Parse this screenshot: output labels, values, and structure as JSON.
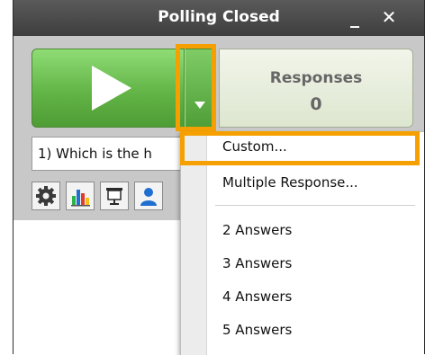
{
  "window": {
    "title": "Polling Closed",
    "minimize_glyph": "_",
    "close_glyph": "✕"
  },
  "poll": {
    "start_button_icon": "play-icon",
    "dropdown_icon": "caret-down-icon",
    "responses_label": "Responses",
    "responses_count": "0",
    "question_text": "1) Which is the h"
  },
  "toolbar_icons": [
    "gear-icon",
    "bar-chart-icon",
    "presentation-icon",
    "user-icon"
  ],
  "dropdown_menu": {
    "items": [
      {
        "label": "Custom..."
      },
      {
        "label": "Multiple Response..."
      },
      {
        "label": "2 Answers"
      },
      {
        "label": "3 Answers"
      },
      {
        "label": "4 Answers"
      },
      {
        "label": "5 Answers"
      }
    ]
  },
  "colors": {
    "highlight": "#f5a000",
    "play_green": "#63b547",
    "titlebar": "#4a4a4a",
    "chart_bars": [
      "#2bb34a",
      "#1f6fd1",
      "#e23b2a",
      "#f3c11b"
    ]
  }
}
